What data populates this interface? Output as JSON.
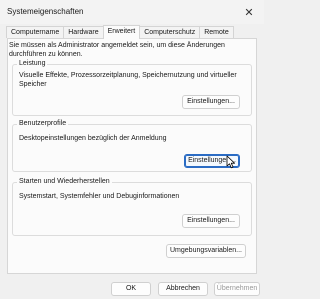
{
  "window": {
    "title": "Systemeigenschaften",
    "close_symbol": "✕"
  },
  "tabs": [
    {
      "label": "Computername",
      "active": false
    },
    {
      "label": "Hardware",
      "active": false
    },
    {
      "label": "Erweitert",
      "active": true
    },
    {
      "label": "Computerschutz",
      "active": false
    },
    {
      "label": "Remote",
      "active": false
    }
  ],
  "admin_note": "Sie müssen als Administrator angemeldet sein, um diese Änderungen durchführen zu können.",
  "groups": {
    "performance": {
      "title": "Leistung",
      "description": "Visuelle Effekte, Prozessorzeitplanung, Speichernutzung und virtueller Speicher",
      "button": "Einstellungen..."
    },
    "user_profiles": {
      "title": "Benutzerprofile",
      "description": "Desktopeinstellungen bezüglich der Anmeldung",
      "button": "Einstellungen..."
    },
    "startup_recovery": {
      "title": "Starten und Wiederherstellen",
      "description": "Systemstart, Systemfehler und Debuginformationen",
      "button": "Einstellungen..."
    }
  },
  "env_button": "Umgebungsvariablen...",
  "footer": {
    "ok": "OK",
    "cancel": "Abbrechen",
    "apply": "Übernehmen"
  }
}
